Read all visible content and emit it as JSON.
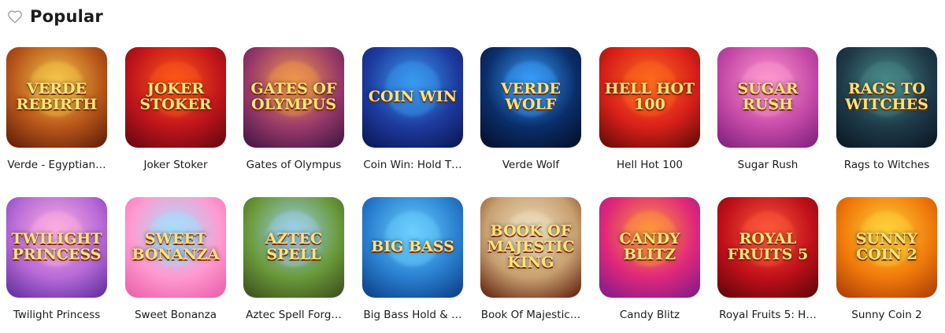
{
  "section": {
    "title": "Popular",
    "icon": "heart-outline-icon"
  },
  "games": [
    {
      "label": "Verde - Egyptian…",
      "art_text": "Verde Rebirth",
      "colors": [
        "#f7c84a",
        "#b9561a",
        "#5a1a06"
      ]
    },
    {
      "label": "Joker Stoker",
      "art_text": "Joker Stoker",
      "colors": [
        "#ff5a1a",
        "#c0151b",
        "#5e0710"
      ]
    },
    {
      "label": "Gates of Olympus",
      "art_text": "Gates of Olympus",
      "colors": [
        "#f19a4a",
        "#9a3a6a",
        "#3b1340"
      ]
    },
    {
      "label": "Coin Win: Hold T…",
      "art_text": "Coin Win",
      "colors": [
        "#3a9bf0",
        "#1d3a9e",
        "#0a1550"
      ]
    },
    {
      "label": "Verde Wolf",
      "art_text": "Verde Wolf",
      "colors": [
        "#3aa0ff",
        "#0a2e6b",
        "#050c25"
      ]
    },
    {
      "label": "Hell Hot 100",
      "art_text": "Hell Hot 100",
      "colors": [
        "#ff6a1e",
        "#d9201a",
        "#5a0a05"
      ]
    },
    {
      "label": "Sugar Rush",
      "art_text": "Sugar Rush",
      "colors": [
        "#ff9ad0",
        "#c64aa8",
        "#7a1e7a"
      ]
    },
    {
      "label": "Rags to Witches",
      "art_text": "Rags to Witches",
      "colors": [
        "#4a8a8a",
        "#1e3a4a",
        "#0a151e"
      ]
    },
    {
      "label": "Twilight Princess",
      "art_text": "Twilight Princess",
      "colors": [
        "#ffb0e0",
        "#b86ad8",
        "#5a2a9a"
      ]
    },
    {
      "label": "Sweet Bonanza",
      "art_text": "Sweet Bonanza",
      "colors": [
        "#a4e0ff",
        "#ff9ad0",
        "#e85aa8"
      ]
    },
    {
      "label": "Aztec Spell Forg…",
      "art_text": "Aztec Spell",
      "colors": [
        "#9ed0f0",
        "#6a9a3a",
        "#3a4a1a"
      ]
    },
    {
      "label": "Big Bass Hold & …",
      "art_text": "Big Bass",
      "colors": [
        "#6ad0ff",
        "#2a80d0",
        "#0a3a80"
      ]
    },
    {
      "label": "Book Of Majestic…",
      "art_text": "Book of Majestic King",
      "colors": [
        "#f0e0c0",
        "#c8a070",
        "#5a1a0a"
      ]
    },
    {
      "label": "Candy Blitz",
      "art_text": "Candy Blitz",
      "colors": [
        "#ff9a3a",
        "#e0287a",
        "#7a1a8a"
      ]
    },
    {
      "label": "Royal Fruits 5: H…",
      "art_text": "Royal Fruits 5",
      "colors": [
        "#ff5a3a",
        "#c0101a",
        "#5a0508"
      ]
    },
    {
      "label": "Sunny Coin 2",
      "art_text": "Sunny Coin 2",
      "colors": [
        "#ffd23a",
        "#f07a0a",
        "#a83a05"
      ]
    }
  ]
}
